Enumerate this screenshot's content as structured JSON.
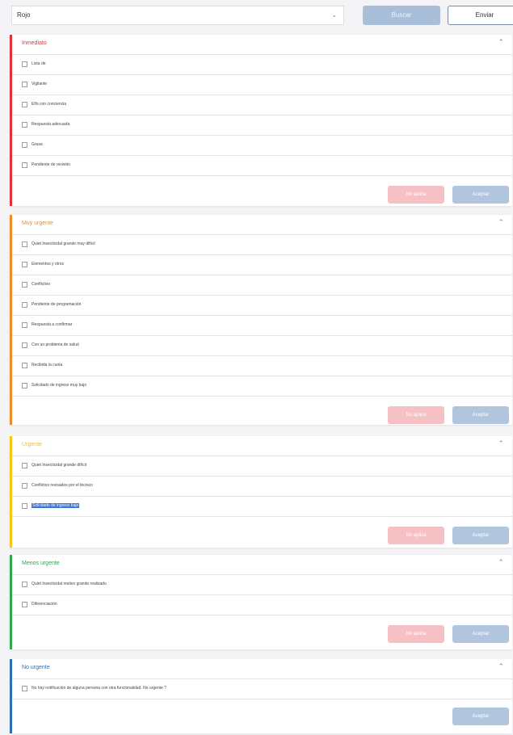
{
  "topbar": {
    "select_value": "Rojo",
    "select_chevron": "chevron-down-icon",
    "primary_label": "Buscar",
    "outline_label": "Enviar"
  },
  "panels": [
    {
      "title": "Inmediato",
      "color": "#e0313a",
      "rows": [
        "Lista de",
        "Vigilante",
        "Elfo con conciencia",
        "Respuesta adecuada",
        "Grasa",
        "Pendiente de revisión"
      ],
      "danger_label": "No aplica",
      "accept_label": "Aceptar"
    },
    {
      "title": "Muy urgente",
      "color": "#f08a24",
      "rows": [
        "Quiet Insecticidal grande muy difícil",
        "Elementos y otros",
        "Conflictivo",
        "Pendiente de programación",
        "Respuesta a confirmar",
        "Con un problema de salud",
        "Recibida la cuota",
        "Solicitado de ingreso muy bajo"
      ],
      "danger_label": "No aplica",
      "accept_label": "Aceptar"
    },
    {
      "title": "Urgente",
      "color": "#f5c518",
      "rows": [
        "Quiet Insecticidal grande difícil",
        "Conflictos revisados por el técnico",
        "Solicitado de ingreso bajo"
      ],
      "selected_row_index": 2,
      "danger_label": "No aplica",
      "accept_label": "Aceptar"
    },
    {
      "title": "Menos urgente",
      "color": "#2ea84e",
      "rows": [
        "Quiet Insecticidal motivo grande realizado",
        "Diferenciación"
      ],
      "danger_label": "No aplica",
      "accept_label": "Aceptar"
    },
    {
      "title": "No urgente",
      "color": "#2f6fb5",
      "rows": [
        "No hay notificación de alguna persona con otra funcionalidad. No urgente ?"
      ],
      "accept_label": "Aceptar"
    }
  ]
}
